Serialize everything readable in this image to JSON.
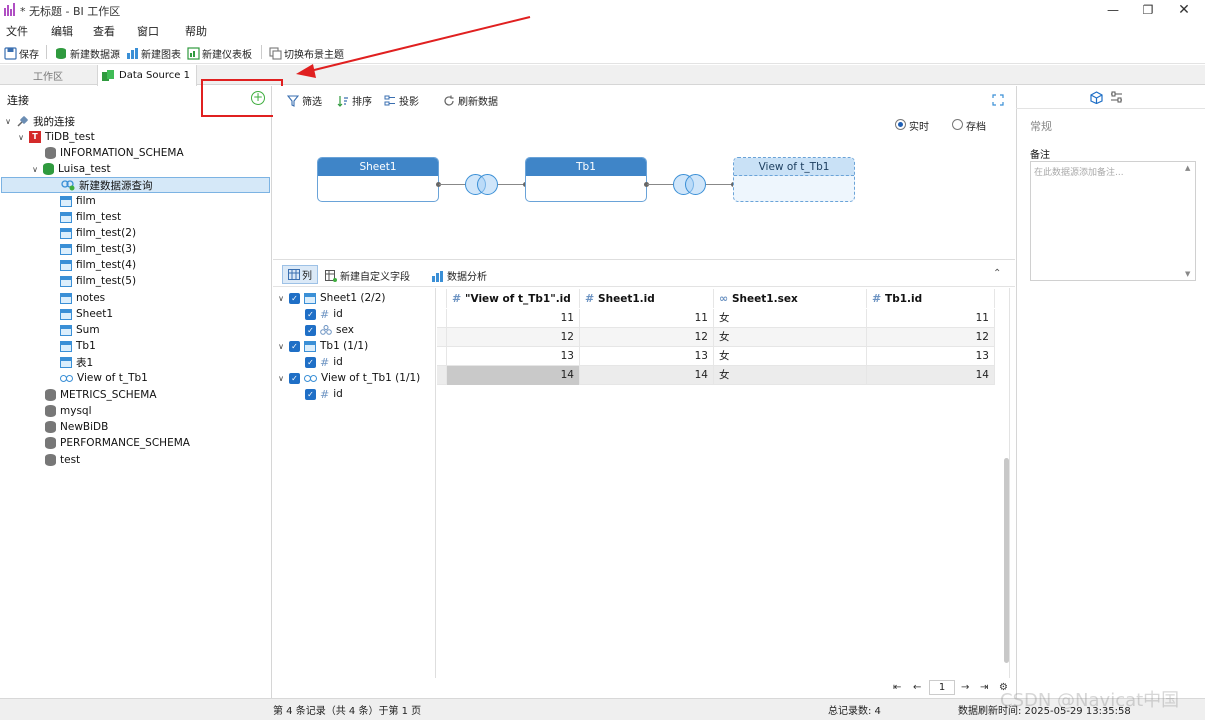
{
  "window": {
    "title": "* 无标题 - BI 工作区"
  },
  "menu": [
    "文件",
    "编辑",
    "查看",
    "窗口",
    "帮助"
  ],
  "toolbar": {
    "save": "保存",
    "new_datasource": "新建数据源",
    "new_chart": "新建图表",
    "new_dashboard": "新建仪表板",
    "switch_theme": "切换布景主题"
  },
  "tabs": {
    "workspace": "工作区",
    "datasource": "Data Source 1"
  },
  "connections": {
    "header": "连接",
    "root": "我的连接",
    "server": "TiDB_test",
    "databases": [
      "INFORMATION_SCHEMA",
      "Luisa_test",
      "METRICS_SCHEMA",
      "mysql",
      "NewBiDB",
      "PERFORMANCE_SCHEMA",
      "test"
    ],
    "new_query": "新建数据源查询",
    "tables": [
      "film",
      "film_test",
      "film_test(2)",
      "film_test(3)",
      "film_test(4)",
      "film_test(5)",
      "notes",
      "Sheet1",
      "Sum",
      "Tb1",
      "表1"
    ],
    "view": "View of t_Tb1"
  },
  "filter_bar": {
    "filter": "筛选",
    "sort": "排序",
    "projection": "投影",
    "refresh": "刷新数据"
  },
  "mode": {
    "realtime": "实时",
    "archive": "存档",
    "selected": "realtime"
  },
  "diagram": {
    "nodes": [
      "Sheet1",
      "Tb1",
      "View of t_Tb1"
    ]
  },
  "lower_bar": {
    "columns": "列",
    "new_field": "新建自定义字段",
    "analysis": "数据分析"
  },
  "fields": {
    "sheet1": "Sheet1 (2/2)",
    "sheet1_fields": [
      "id",
      "sex"
    ],
    "tb1": "Tb1 (1/1)",
    "tb1_fields": [
      "id"
    ],
    "view": "View of t_Tb1 (1/1)",
    "view_fields": [
      "id"
    ]
  },
  "grid": {
    "headers": [
      "\"View of t_Tb1\".id",
      "Sheet1.id",
      "Sheet1.sex",
      "Tb1.id"
    ],
    "rows": [
      [
        "11",
        "11",
        "女",
        "11"
      ],
      [
        "12",
        "12",
        "女",
        "12"
      ],
      [
        "13",
        "13",
        "女",
        "13"
      ],
      [
        "14",
        "14",
        "女",
        "14"
      ]
    ]
  },
  "pager": {
    "page": "1"
  },
  "status": {
    "records": "第 4 条记录（共 4 条）于第 1 页",
    "total": "总记录数: 4",
    "refresh_time": "数据刷新时间: 2025-05-29 13:35:58"
  },
  "right_panel": {
    "general": "常规",
    "notes_label": "备注",
    "notes_placeholder": "在此数据源添加备注..."
  },
  "watermark": "CSDN @Navicat中国",
  "colors": {
    "accent": "#3f85c8",
    "highlight": "#e02020",
    "selected_row": "#d5e8f8"
  }
}
